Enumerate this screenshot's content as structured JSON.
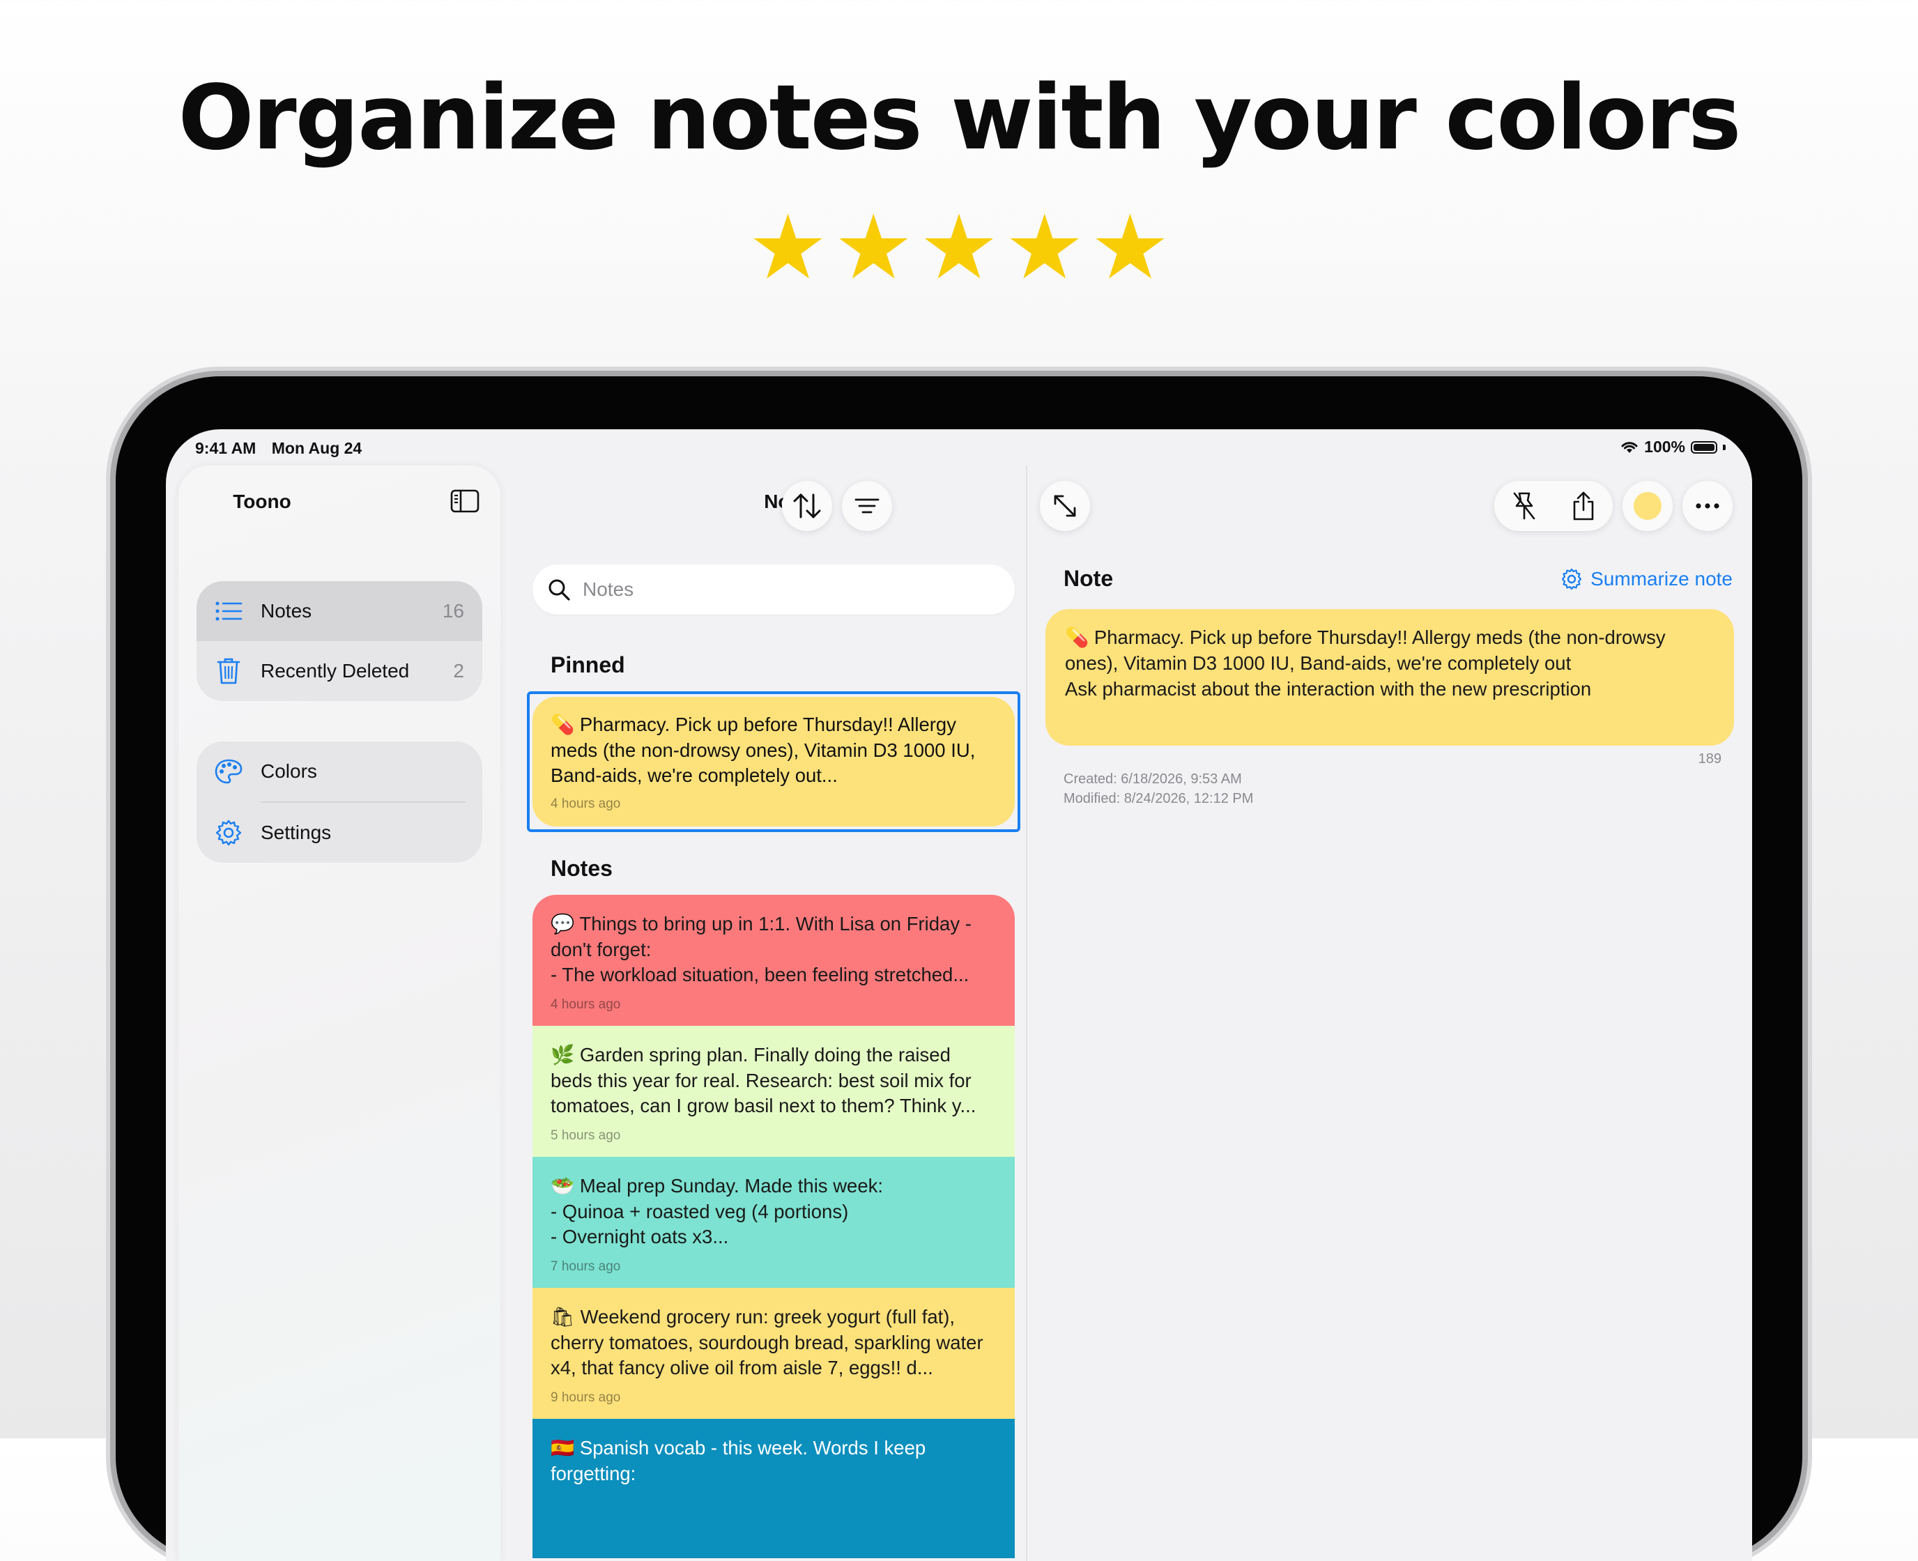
{
  "headline": "Organize notes with your colors",
  "rating": {
    "stars": 5,
    "max": 5,
    "glyph": "★",
    "color": "#f8cd05"
  },
  "status_bar": {
    "time": "9:41 AM",
    "date": "Mon Aug 24",
    "battery": "100%"
  },
  "sidebar": {
    "title": "Toono",
    "groups": [
      {
        "items": [
          {
            "label": "Notes",
            "count": "16",
            "icon": "list-icon",
            "selected": true
          },
          {
            "label": "Recently Deleted",
            "count": "2",
            "icon": "trash-icon"
          }
        ]
      },
      {
        "items": [
          {
            "label": "Colors",
            "icon": "palette-icon"
          },
          {
            "label": "Settings",
            "icon": "gear-icon"
          }
        ]
      }
    ]
  },
  "list": {
    "title": "Notes",
    "search_placeholder": "Notes",
    "pinned_header": "Pinned",
    "notes_header": "Notes",
    "pinned": {
      "emoji": "💊",
      "text": "Pharmacy. Pick up before Thursday!! Allergy meds (the non-drowsy ones), Vitamin D3 1000 IU, Band-aids, we're completely out...",
      "time": "4 hours ago",
      "color": "#fde17b"
    },
    "notes": [
      {
        "emoji": "💬",
        "text": "Things to bring up in 1:1. With Lisa on Friday - don't forget:\n- The workload situation, been feeling stretched...",
        "time": "4 hours ago",
        "color": "#fc7a7c"
      },
      {
        "emoji": "🌿",
        "text": "Garden spring plan. Finally doing the raised beds this year for real. Research: best soil mix for tomatoes, can I grow basil next to them? Think y...",
        "time": "5 hours ago",
        "color": "#e5fbc6"
      },
      {
        "emoji": "🥗",
        "text": "Meal prep Sunday. Made this week:\n- Quinoa + roasted veg (4 portions)\n- Overnight oats x3...",
        "time": "7 hours ago",
        "color": "#7de2d1"
      },
      {
        "emoji": "🛍",
        "text": "Weekend grocery run: greek yogurt (full fat), cherry tomatoes, sourdough bread, sparkling water x4, that fancy olive oil from aisle 7, eggs!! d...",
        "time": "9 hours ago",
        "color": "#fde17b"
      },
      {
        "emoji": "🇪🇸",
        "text": "Spanish vocab - this week. Words I keep forgetting:",
        "time": "",
        "color": "#0b8fbd"
      }
    ]
  },
  "detail": {
    "heading": "Note",
    "summarize_label": "Summarize note",
    "body_emoji": "💊",
    "body": "Pharmacy. Pick up before Thursday!! Allergy meds (the non-drowsy ones), Vitamin D3 1000 IU, Band-aids, we're completely out\nAsk pharmacist about the interaction with the new prescription",
    "char_count": "189",
    "created": "Created: 6/18/2026, 9:53 AM",
    "modified": "Modified: 8/24/2026, 12:12 PM",
    "note_color": "#fde17b"
  }
}
